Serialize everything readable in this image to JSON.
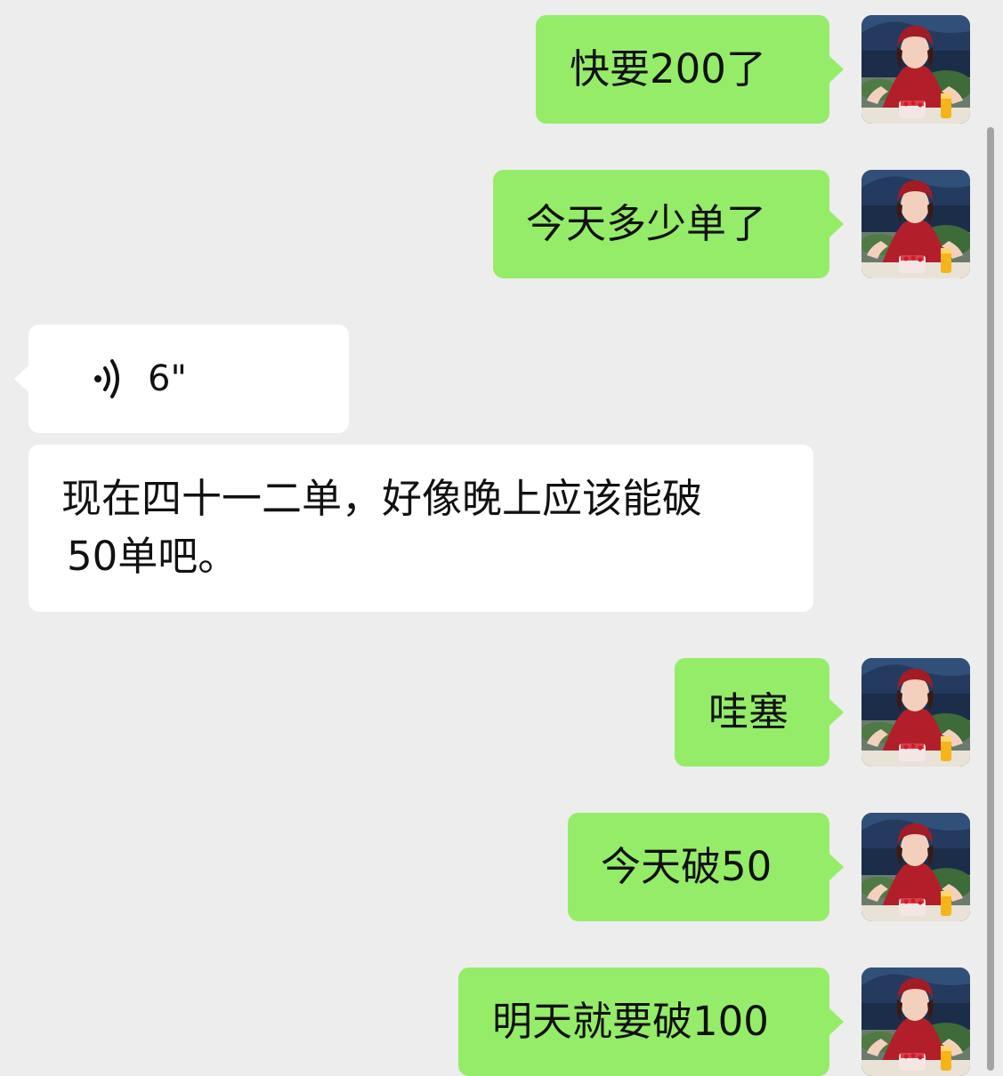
{
  "messages": [
    {
      "id": "m1",
      "type": "text",
      "direction": "sent",
      "text": "快要200了"
    },
    {
      "id": "m2",
      "type": "text",
      "direction": "sent",
      "text": "今天多少单了"
    },
    {
      "id": "m3",
      "type": "voice",
      "direction": "received",
      "duration": "6\""
    },
    {
      "id": "m4",
      "type": "text",
      "direction": "received",
      "lines": [
        "现在四十一二单，好像晚上应该能破",
        "50单吧。"
      ]
    },
    {
      "id": "m5",
      "type": "text",
      "direction": "sent",
      "text": "哇塞"
    },
    {
      "id": "m6",
      "type": "text",
      "direction": "sent",
      "text": "今天破50"
    },
    {
      "id": "m7",
      "type": "text",
      "direction": "sent",
      "text": "明天就要破100"
    }
  ],
  "colors": {
    "background": "#ededed",
    "sent_bubble": "#95ec69",
    "received_bubble": "#ffffff",
    "text": "#111111"
  },
  "icons": {
    "voice": "voice-wave-icon",
    "avatar": "user-avatar"
  }
}
